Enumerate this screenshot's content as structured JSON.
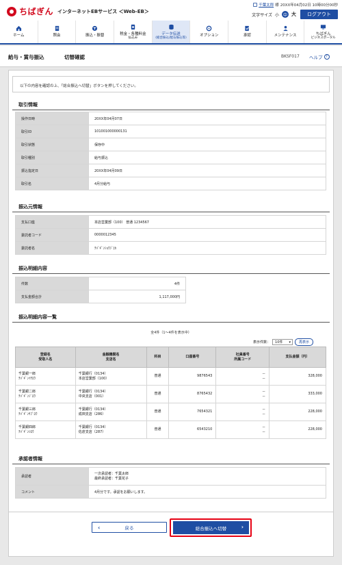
{
  "header": {
    "logo_text": "ちばぎん",
    "service_name": "インターネットEBサービス ＜Web-EB＞",
    "user_name": "千葉太郎",
    "user_suffix": "様",
    "last_login": "20XX年04月02日 10時00分00秒",
    "text_size_label": "文字サイズ",
    "text_size_small": "小",
    "text_size_medium": "中",
    "text_size_large": "大",
    "logout_label": "ログアウト"
  },
  "nav": [
    {
      "label": "ホーム",
      "sub": ""
    },
    {
      "label": "照会",
      "sub": ""
    },
    {
      "label": "振込・振替",
      "sub": ""
    },
    {
      "label": "税金・各種料金",
      "sub": "払込み"
    },
    {
      "label": "データ伝送",
      "sub": "(総合振込/給与振込等)"
    },
    {
      "label": "オプション",
      "sub": ""
    },
    {
      "label": "承認",
      "sub": ""
    },
    {
      "label": "メンテナンス",
      "sub": ""
    },
    {
      "label": "ちばぎん",
      "sub": "ビジネスポータル"
    }
  ],
  "page": {
    "title_main": "給与・賞与振込",
    "title_sub": "切替確認",
    "screen_id": "BKSF017",
    "help_label": "ヘルプ",
    "instruction": "以下の内容を確認の上、「総合振込へ切替」ボタンを押してください。"
  },
  "transaction": {
    "title": "取引情報",
    "rows": [
      {
        "k": "操作日時",
        "v": "20XX年04月07日"
      },
      {
        "k": "取引ID",
        "v": "101001000000131"
      },
      {
        "k": "取引状態",
        "v": "保存中"
      },
      {
        "k": "取引種別",
        "v": "給与振込"
      },
      {
        "k": "振込指定日",
        "v": "20XX年04月09日"
      },
      {
        "k": "取引名",
        "v": "4月分給与"
      }
    ]
  },
  "source": {
    "title": "振込元情報",
    "rows": [
      {
        "k": "支払口座",
        "v": "本店営業部（100） 普通 1234567"
      },
      {
        "k": "委託者コード",
        "v": "0000012345"
      },
      {
        "k": "委託者名",
        "v": "ﾁﾊﾞｷﾞﾝｼｮｳｼﾞ(ｶ"
      }
    ]
  },
  "detail": {
    "title": "振込明細内容",
    "rows": [
      {
        "k": "件数",
        "v": "4件"
      },
      {
        "k": "支払金額合計",
        "v": "1,117,000円"
      }
    ]
  },
  "list": {
    "title": "振込明細内容一覧",
    "count_text": "全4件（1～4件を表示中）",
    "per_page_label": "表示件数：",
    "per_page_value": "10件",
    "redisplay_label": "再表示",
    "headers": [
      {
        "l1": "登録名",
        "l2": "受取人名"
      },
      {
        "l1": "金融機関名",
        "l2": "支店名"
      },
      {
        "l1": "科目",
        "l2": ""
      },
      {
        "l1": "口座番号",
        "l2": ""
      },
      {
        "l1": "社員番号",
        "l2": "所属コード"
      },
      {
        "l1": "支払金額（円）",
        "l2": ""
      }
    ],
    "rows": [
      {
        "reg": "千葉銀一郎",
        "kana": "ﾁﾊﾞｷﾞﾝｲﾁﾛｳ",
        "bank": "千葉銀行（0134）",
        "branch": "本店営業部（100）",
        "type": "普通",
        "acct": "9876543",
        "emp": "－",
        "dept": "－",
        "amount": "328,000"
      },
      {
        "reg": "千葉銀二郎",
        "kana": "ﾁﾊﾞｷﾞﾝｼﾞﾛｳ",
        "bank": "千葉銀行（0134）",
        "branch": "中央支店（001）",
        "type": "普通",
        "acct": "8765432",
        "emp": "－",
        "dept": "－",
        "amount": "333,000"
      },
      {
        "reg": "千葉銀三郎",
        "kana": "ﾁﾊﾞｷﾞﾝｻﾌﾞﾛｳ",
        "bank": "千葉銀行（0134）",
        "branch": "成田支店（286）",
        "type": "普通",
        "acct": "7654321",
        "emp": "－",
        "dept": "－",
        "amount": "228,000"
      },
      {
        "reg": "千葉銀四郎",
        "kana": "ﾁﾊﾞｷﾞﾝｼﾛｳ",
        "bank": "千葉銀行（0134）",
        "branch": "佐倉支店（287）",
        "type": "普通",
        "acct": "6543210",
        "emp": "－",
        "dept": "－",
        "amount": "228,000"
      }
    ]
  },
  "approver": {
    "title": "承認者情報",
    "approver_label": "承認者",
    "approver_line1": "一次承認者：千葉太郎",
    "approver_line2": "最終承認者：千葉花子",
    "comment_label": "コメント",
    "comment_value": "4月分です。承認をお願いします。"
  },
  "buttons": {
    "back_label": "戻る",
    "switch_label": "総合振込へ切替"
  },
  "colors": {
    "brand_red": "#d20a1e",
    "primary_blue": "#1f4ea3",
    "highlight_red": "#e60012"
  }
}
